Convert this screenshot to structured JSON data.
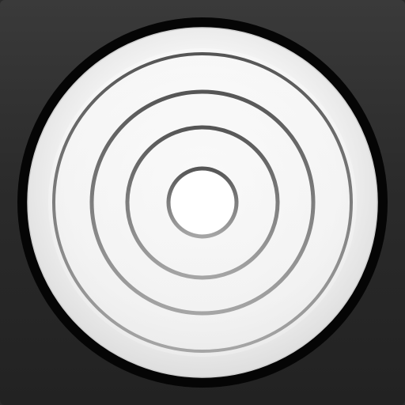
{
  "icon": {
    "name": "concentric-rings-icon",
    "colors": {
      "background": "#2b2b2b",
      "outer_rim": "#0a0a0a",
      "disc_light": "#f7f7f7",
      "disc_edge": "#dcdcdc",
      "ring_stroke_dark": "#5e5e5e",
      "ring_stroke_light": "#9a9a9a"
    }
  }
}
